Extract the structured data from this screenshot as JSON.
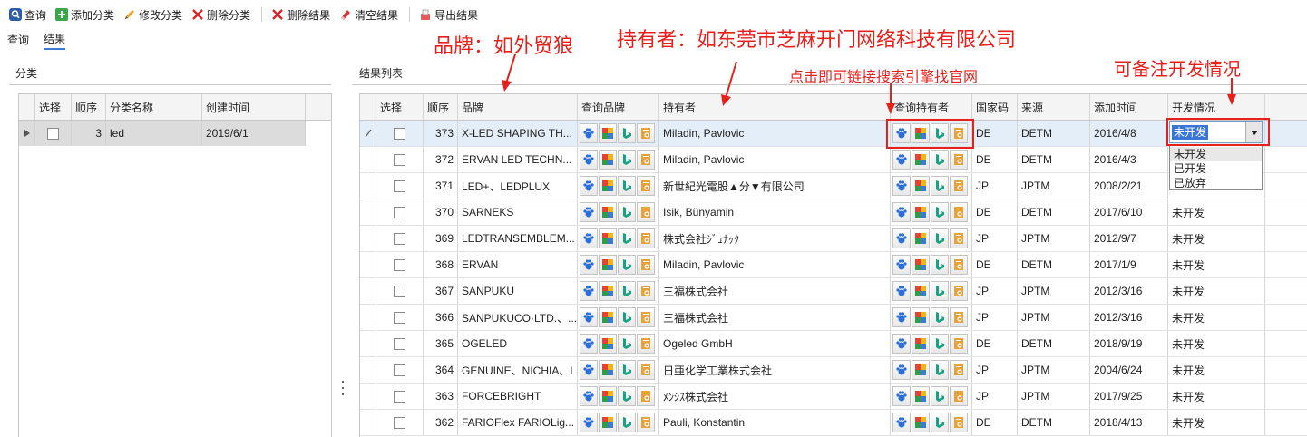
{
  "toolbar": {
    "buttons": [
      {
        "label": "查询",
        "icon": "search-icon"
      },
      {
        "label": "添加分类",
        "icon": "add-icon"
      },
      {
        "label": "修改分类",
        "icon": "pencil-icon"
      },
      {
        "label": "删除分类",
        "icon": "delete-x-icon"
      },
      {
        "label": "删除结果",
        "icon": "delete-x-icon"
      },
      {
        "label": "清空结果",
        "icon": "eraser-icon"
      },
      {
        "label": "导出结果",
        "icon": "export-icon"
      }
    ]
  },
  "tabs": [
    {
      "label": "查询",
      "active": false
    },
    {
      "label": "结果",
      "active": true
    }
  ],
  "left": {
    "title": "分类",
    "columns": [
      "选择",
      "顺序",
      "分类名称",
      "创建时间"
    ],
    "rows": [
      {
        "order": "3",
        "name": "led",
        "created": "2019/6/1"
      }
    ]
  },
  "right": {
    "title": "结果列表",
    "columns": [
      "选择",
      "顺序",
      "品牌",
      "查询品牌",
      "持有者",
      "查询持有者",
      "国家码",
      "来源",
      "添加时间",
      "开发情况"
    ],
    "rows": [
      {
        "order": "373",
        "brand": "X-LED SHAPING TH...",
        "holder": "Miladin, Pavlovic",
        "cc": "DE",
        "source": "DETM",
        "date": "2016/4/8",
        "dev": ""
      },
      {
        "order": "372",
        "brand": "ERVAN LED TECHN...",
        "holder": "Miladin, Pavlovic",
        "cc": "DE",
        "source": "DETM",
        "date": "2016/4/3",
        "dev": ""
      },
      {
        "order": "371",
        "brand": "LED+、LEDPLUX",
        "holder": "新世紀光電股▲分▼有限公司",
        "cc": "JP",
        "source": "JPTM",
        "date": "2008/2/21",
        "dev": ""
      },
      {
        "order": "370",
        "brand": "SARNEKS",
        "holder": "Isik, Bünyamin",
        "cc": "DE",
        "source": "DETM",
        "date": "2017/6/10",
        "dev": "未开发"
      },
      {
        "order": "369",
        "brand": "LEDTRANSEMBLEM...",
        "holder": "株式会社ｼﾞｭﾅｯｸ",
        "cc": "JP",
        "source": "JPTM",
        "date": "2012/9/7",
        "dev": "未开发"
      },
      {
        "order": "368",
        "brand": "ERVAN",
        "holder": "Miladin, Pavlovic",
        "cc": "DE",
        "source": "DETM",
        "date": "2017/1/9",
        "dev": "未开发"
      },
      {
        "order": "367",
        "brand": "SANPUKU",
        "holder": "三福株式会社",
        "cc": "JP",
        "source": "JPTM",
        "date": "2012/3/16",
        "dev": "未开发"
      },
      {
        "order": "366",
        "brand": "SANPUKUCO·LTD.、...",
        "holder": "三福株式会社",
        "cc": "JP",
        "source": "JPTM",
        "date": "2012/3/16",
        "dev": "未开发"
      },
      {
        "order": "365",
        "brand": "OGELED",
        "holder": "Ogeled GmbH",
        "cc": "DE",
        "source": "DETM",
        "date": "2018/9/19",
        "dev": "未开发"
      },
      {
        "order": "364",
        "brand": "GENUINE、NICHIA、L...",
        "holder": "日亜化学工業株式会社",
        "cc": "JP",
        "source": "JPTM",
        "date": "2004/6/24",
        "dev": "未开发"
      },
      {
        "order": "363",
        "brand": "FORCEBRIGHT",
        "holder": "ﾒﾝｼｽ株式会社",
        "cc": "JP",
        "source": "JPTM",
        "date": "2017/9/25",
        "dev": "未开发"
      },
      {
        "order": "362",
        "brand": "FARIOFlex FARIOLig...",
        "holder": "Pauli, Konstantin",
        "cc": "DE",
        "source": "DETM",
        "date": "2018/4/13",
        "dev": "未开发"
      }
    ],
    "search_icons": [
      "baidu-paw-icon",
      "google-icon",
      "bing-icon",
      "book-search-icon"
    ]
  },
  "dropdown": {
    "value": "未开发",
    "options": [
      "未开发",
      "已开发",
      "已放弃"
    ]
  },
  "annotations": {
    "brand": "品牌：如外贸狼",
    "holder": "持有者：如东莞市芝麻开门网络科技有限公司",
    "link": "点击即可链接搜索引擎找官网",
    "note": "可备注开发情况"
  }
}
